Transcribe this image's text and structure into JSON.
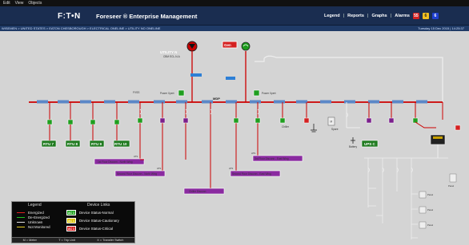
{
  "menu": {
    "items": [
      "Edit",
      "View",
      "Objects"
    ]
  },
  "header": {
    "logo": "F:T•N",
    "title": "Foreseer ® Enterprise Management",
    "nav": [
      "Legend",
      "Reports",
      "Graphs",
      "Alarms"
    ],
    "alarm_counts": [
      "55",
      "6",
      "6"
    ],
    "alarm_colors": [
      "#d42020",
      "#f0c020",
      "#2040d0"
    ]
  },
  "breadcrumb": "WISEMEN > UNITED STATES > EATON CHESBOROUGH > ELECTRICAL ONELINE > UTILITY NO ONELINE",
  "timestamp": "Tuesday 15 Dec 2015 | 14:25:37",
  "diagram": {
    "utility_label": "UTILITY N",
    "utility_sub": "CBM ECL-N-A",
    "gen_label": "Gen",
    "mdp_label": "MDP",
    "fvss_label": "FVSS",
    "power_xpert_1": "Power Xpert",
    "power_xpert_2": "Power Xpert",
    "rtu_labels": [
      "RTU 7",
      "RTU 8",
      "RTU 9",
      "RTU 10"
    ],
    "ups_label": "UPS C",
    "spare_label": "Spare",
    "battery_label": "Battery",
    "chiller_label": "Chiller",
    "panel_labels": [
      "Panel",
      "Panel",
      "Panel",
      "Panel"
    ],
    "panel_sub": "Distribution Panel",
    "sub_labels": [
      "1st Floor Disconn - North Wing",
      "Second Floor Disconn - North Wing",
      "3rd Floor Disconn - East Wing",
      "Second Floor Disconn - East Wing",
      "Chiller Disconn"
    ],
    "breaker_tags": [
      "ATS",
      "ATS",
      "ATS",
      "ATS"
    ]
  },
  "legend": {
    "title_left": "Legend",
    "title_right": "Device Links",
    "items": [
      {
        "label": "Energized",
        "color": "#e02020"
      },
      {
        "label": "De-Energized",
        "color": "#20c020"
      },
      {
        "label": "Unknown",
        "color": "#e0e0e0"
      },
      {
        "label": "Not Monitored",
        "color": "#e8d020"
      }
    ],
    "devices": [
      {
        "badge": "AC 1",
        "label": "Device Status-Normal",
        "color": "#22a322"
      },
      {
        "badge": "AC 1",
        "label": "Device Status-Cautionary",
        "color": "#d9c200"
      },
      {
        "badge": "AC 1",
        "label": "Device Status-Critical",
        "color": "#d42020"
      }
    ],
    "footer": [
      "M = Meter",
      "T = Trip Unit",
      "X = Transfer Switch"
    ]
  }
}
